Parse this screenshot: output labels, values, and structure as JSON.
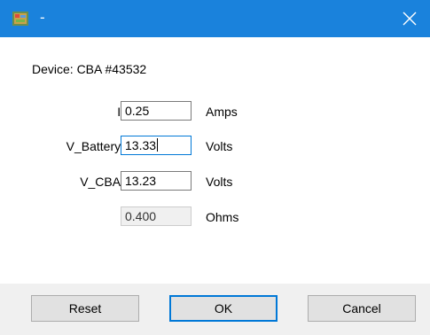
{
  "window": {
    "title": "-",
    "titlebar_color": "#1a82dc",
    "icon": "app-icon",
    "close_icon": "close-icon"
  },
  "form": {
    "device_label": "Device: CBA #43532",
    "rows": [
      {
        "label": "I:",
        "value": "0.25",
        "unit": "Amps"
      },
      {
        "label": "V_Battery:",
        "value": "13.33",
        "unit": "Volts"
      },
      {
        "label": "V_CBA:",
        "value": "13.23",
        "unit": "Volts"
      },
      {
        "label": "",
        "value": "0.400",
        "unit": "Ohms"
      }
    ]
  },
  "buttons": {
    "reset": "Reset",
    "ok": "OK",
    "cancel": "Cancel"
  }
}
